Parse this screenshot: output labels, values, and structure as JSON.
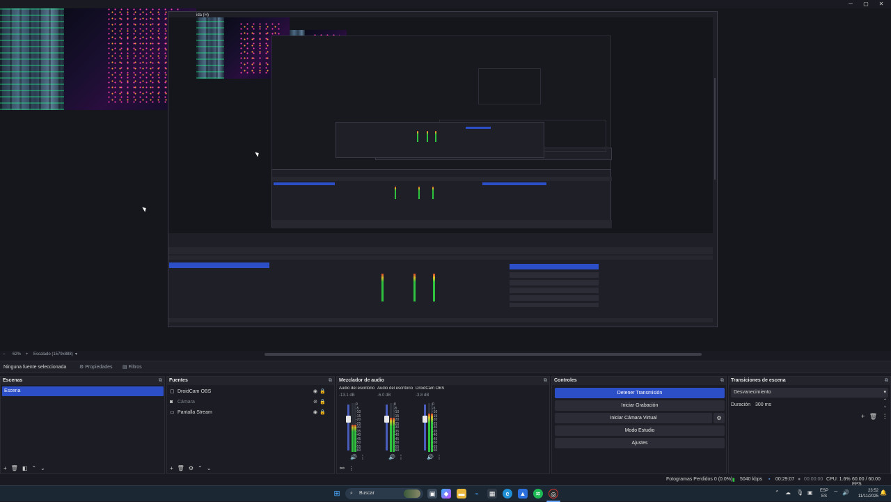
{
  "window": {
    "controls": {
      "minimize": "─",
      "maximize": "▢",
      "close": "✕"
    }
  },
  "preview": {
    "nested_title": "ida (H)"
  },
  "zoombar": {
    "zoom": "62%",
    "scale_label": "Escalado (1579x888)"
  },
  "context_bar": {
    "no_selection": "Ninguna fuente seleccionada",
    "properties": "Propiedades",
    "filters": "Filtros"
  },
  "scenes": {
    "title": "Escenas",
    "items": [
      "Escena"
    ]
  },
  "sources": {
    "title": "Fuentes",
    "items": [
      {
        "label": "DroidCam OBS",
        "icon": "camera-icon"
      },
      {
        "label": "Cámara",
        "icon": "camera-icon"
      },
      {
        "label": "Pantalla Stream",
        "icon": "monitor-icon"
      }
    ]
  },
  "mixer": {
    "title": "Mezclador de audio",
    "channels": [
      {
        "name": "Audio del escritorio",
        "db": "-13.1 dB",
        "level": 0.55
      },
      {
        "name": "Audio del escritorio",
        "db": "-6.0 dB",
        "level": 0.7
      },
      {
        "name": "DroidCam OBS",
        "db": "-3.8 dB",
        "level": 0.78
      }
    ],
    "scale": [
      "0",
      "-5",
      "-10",
      "-15",
      "-20",
      "-25",
      "-30",
      "-35",
      "-40",
      "-45",
      "-50",
      "-55",
      "-60"
    ]
  },
  "controls": {
    "title": "Controles",
    "stop_stream": "Detener Transmisión",
    "start_recording": "Iniciar Grabación",
    "start_virtual_cam": "Iniciar Cámara Virtual",
    "studio_mode": "Modo Estudio",
    "settings": "Ajustes"
  },
  "transitions": {
    "title": "Transiciones de escena",
    "selected": "Desvanecimiento",
    "duration_label": "Duración",
    "duration_value": "300 ms"
  },
  "status": {
    "dropped_frames": "Fotogramas Perdidos 0 (0.0%)",
    "bitrate": "5040 kbps",
    "stream_time": "00:29:07",
    "rec_time": "00:00:00",
    "cpu": "CPU: 1.6%",
    "fps": "60.00 / 60.00 FPS"
  },
  "taskbar": {
    "search_placeholder": "Buscar",
    "lang": "ESP",
    "lang_sub": "ES",
    "time": "23:52",
    "date": "11/11/2025"
  },
  "colors": {
    "accent": "#2c4ec6",
    "background": "#1a1b22",
    "panel": "#1c1d24"
  }
}
